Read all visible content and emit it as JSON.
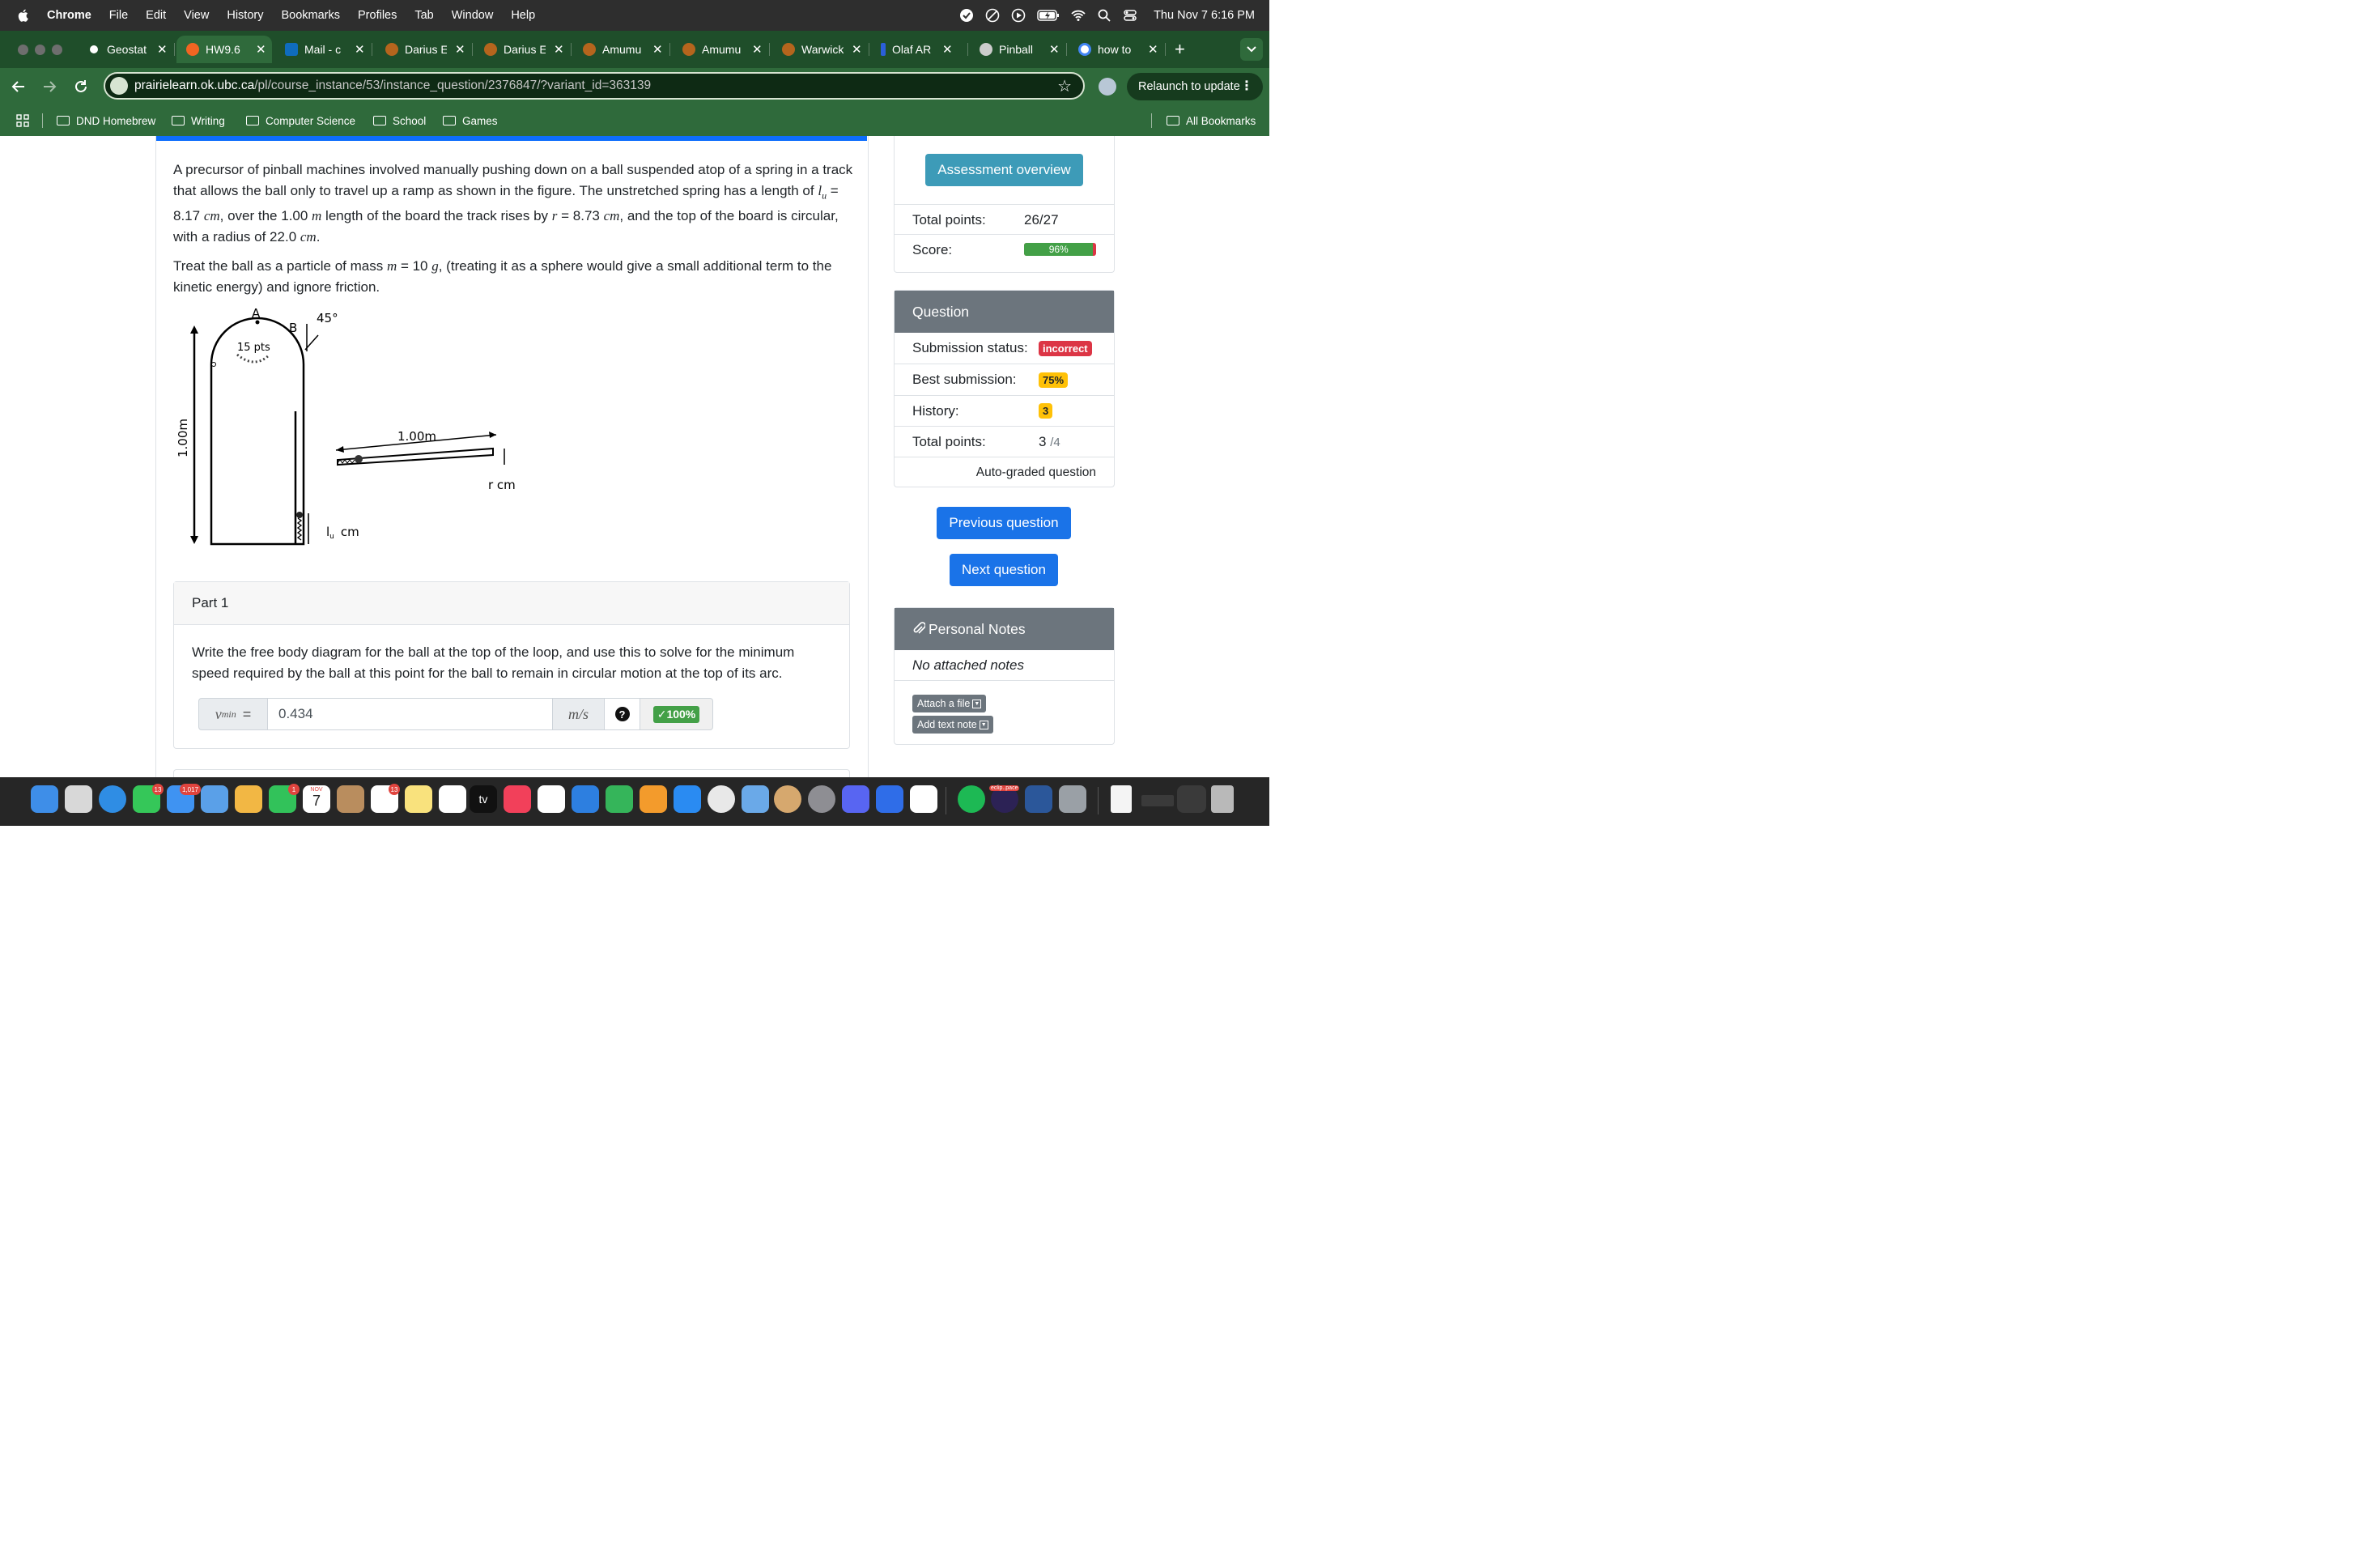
{
  "menubar": {
    "items": [
      "Chrome",
      "File",
      "Edit",
      "View",
      "History",
      "Bookmarks",
      "Profiles",
      "Tab",
      "Window",
      "Help"
    ],
    "clock": "Thu Nov 7  6:16 PM"
  },
  "tabs": [
    {
      "label": "Geostat",
      "color": "#ffffff"
    },
    {
      "label": "HW9.6",
      "color": "#f26522"
    },
    {
      "label": "Mail - c",
      "color": "#0f6cbd"
    },
    {
      "label": "Darius E",
      "color": "#b5651d"
    },
    {
      "label": "Darius E",
      "color": "#b5651d"
    },
    {
      "label": "Amumu",
      "color": "#b5651d"
    },
    {
      "label": "Amumu",
      "color": "#b5651d"
    },
    {
      "label": "Warwick",
      "color": "#b5651d"
    },
    {
      "label": "Olaf AR",
      "color": "#2b5fd9"
    },
    {
      "label": "Pinball",
      "color": "#cccccc"
    },
    {
      "label": "how to",
      "color": "#ffffff"
    }
  ],
  "address": {
    "host": "prairielearn.ok.ubc.ca",
    "path": "/pl/course_instance/53/instance_question/2376847/?variant_id=363139"
  },
  "relaunch_label": "Relaunch to update",
  "bookmarks": [
    "DND Homebrew",
    "Writing",
    "Computer Science",
    "School",
    "Games"
  ],
  "all_bookmarks": "All Bookmarks",
  "question": {
    "p1_a": "A precursor of pinball machines involved manually pushing down on a ball suspended atop of a spring in a track that allows the ball only to travel up a ramp as shown in the figure. The unstretched spring has a length of ",
    "p1_lu": "l",
    "p1_lu_sub": "u",
    "p1_b": " = 8.17 ",
    "p1_cm": "cm",
    "p1_c": ", over the 1.00 ",
    "p1_m": "m",
    "p1_d": " length of the board the track rises by ",
    "p1_r": "r",
    "p1_e": " = 8.73 ",
    "p1_cm2": "cm",
    "p1_f": ", and the top of the board is circular, with a radius of 22.0 ",
    "p1_cm3": "cm",
    "p1_g": ".",
    "p2_a": "Treat the ball as a particle of mass ",
    "p2_m": "m",
    "p2_b": " = 10 ",
    "p2_g": "g",
    "p2_c": ", (treating it as a sphere would give a small additional term to the kinetic energy) and ignore friction."
  },
  "figure": {
    "label_A": "A",
    "label_B": "B",
    "label_angle": "45°",
    "label_pts": "15 pts",
    "label_height": "1.00m",
    "label_board": "1.00m",
    "label_r": "r  cm",
    "label_lu": "l",
    "label_lu_sub": "u",
    "label_lu_unit": "cm"
  },
  "part": {
    "title": "Part 1",
    "prompt": "Write the free body diagram for the ball at the top of the loop, and use this to solve for the minimum speed required by the ball at this point for the ball to remain in circular motion at the top of its arc.",
    "var_label": "v",
    "var_sub": "min",
    "eq": "=",
    "value": "0.434",
    "unit": "m/s",
    "help": "?",
    "score_badge": "✓100%"
  },
  "sidebar": {
    "assessment_overview": "Assessment overview",
    "total_points_label": "Total points:",
    "total_points_value": "26/27",
    "score_label": "Score:",
    "score_value": "96%",
    "score_fraction": 0.96,
    "question_header": "Question",
    "submission_status_label": "Submission status:",
    "submission_status_value": "incorrect",
    "best_submission_label": "Best submission:",
    "best_submission_value": "75%",
    "history_label": "History:",
    "history_value": "3",
    "q_total_points_label": "Total points:",
    "q_total_points_value": "3",
    "q_total_points_max": "/4",
    "auto_graded": "Auto-graded question",
    "previous_question": "Previous question",
    "next_question": "Next question",
    "notes_header": "Personal Notes",
    "no_notes": "No attached notes",
    "attach_file": "Attach a file",
    "add_text_note": "Add text note"
  },
  "dock": {
    "badges": {
      "messages": "13",
      "mail": "1,017",
      "facetime": "1",
      "reminders": "13"
    },
    "calendar_month": "NOV",
    "calendar_day": "7",
    "tv_label": "tv",
    "eclipse_label": "eclip..pace"
  },
  "colors": {
    "chrome_green": "#2f6a3b",
    "link_blue": "#1a73e8",
    "assessment_teal": "#3d9bb8",
    "success": "#43a047",
    "danger": "#dc3545",
    "warning": "#ffc107",
    "header_gray": "#6c757d"
  }
}
